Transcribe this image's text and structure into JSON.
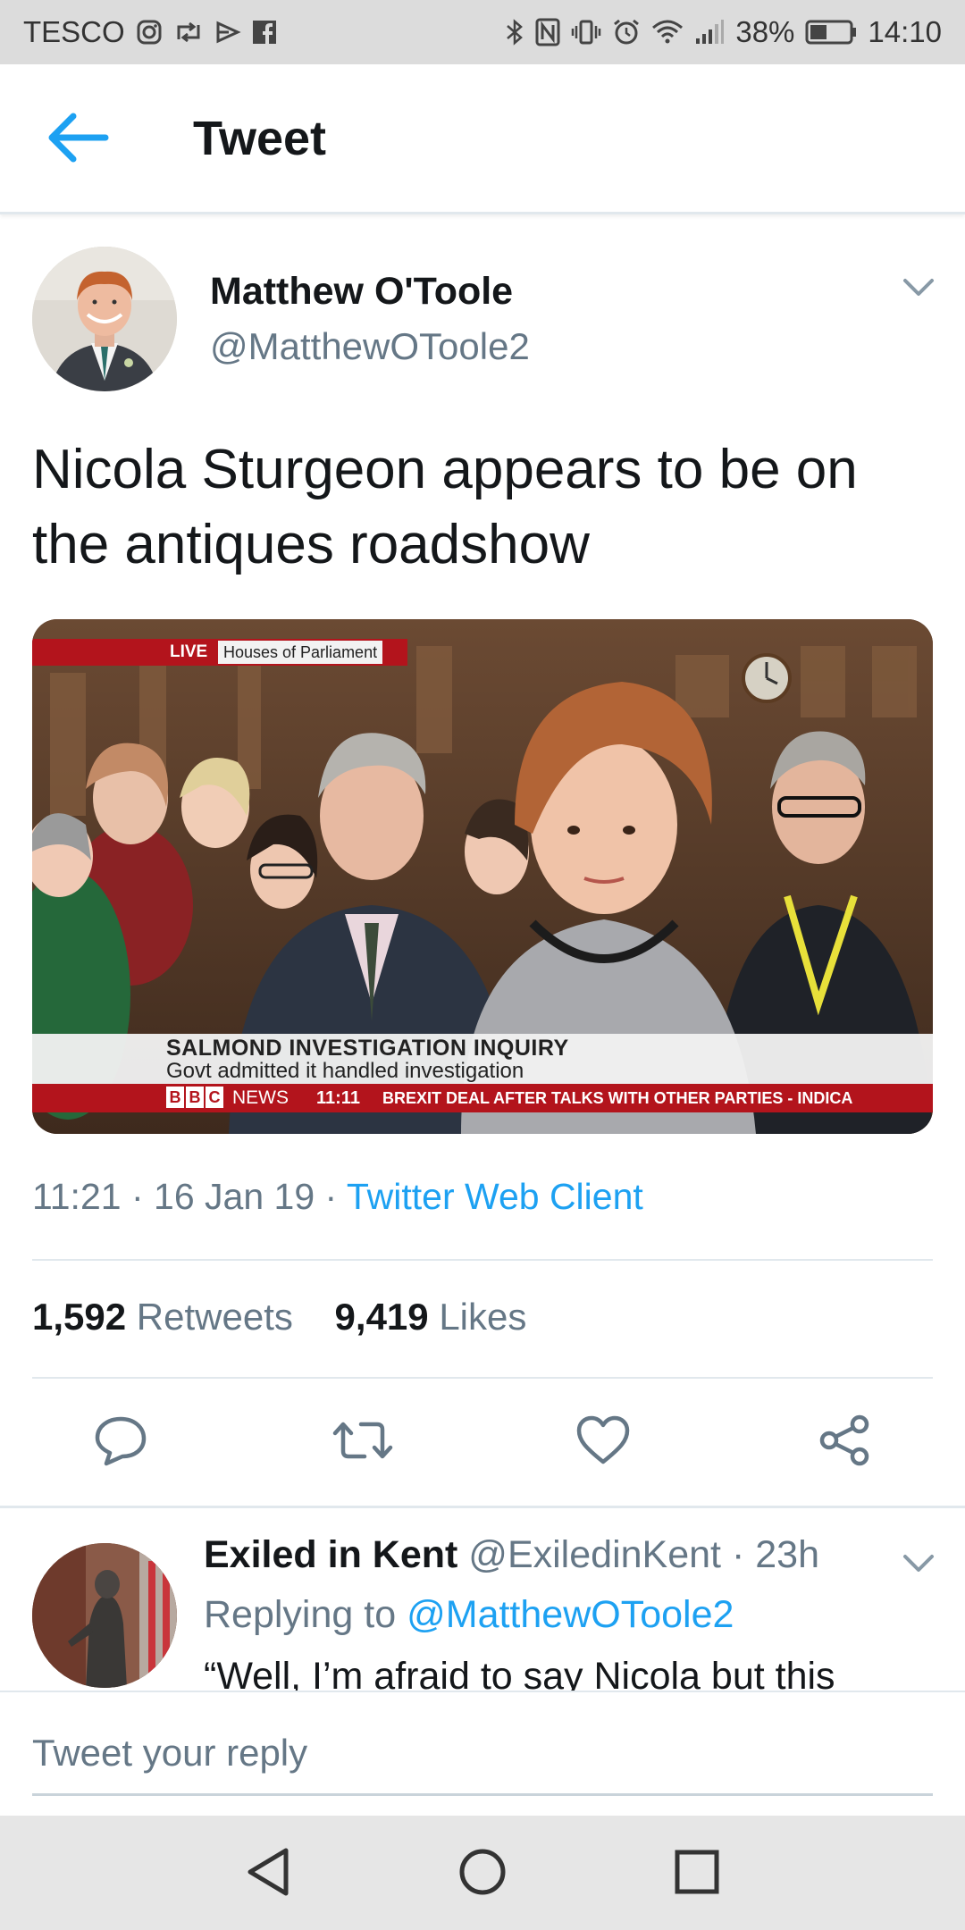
{
  "status_bar": {
    "carrier": "TESCO",
    "battery": "38%",
    "time": "14:10"
  },
  "app_bar": {
    "title": "Tweet"
  },
  "tweet": {
    "author_name": "Matthew O'Toole",
    "author_handle": "@MatthewOToole2",
    "text": "Nicola Sturgeon appears to be on the antiques roadshow",
    "media": {
      "live_label": "LIVE",
      "location_label": "Houses of Parliament",
      "headline": "SALMOND INVESTIGATION INQUIRY",
      "subheadline": "Govt admitted it handled investigation",
      "channel_letters": [
        "B",
        "B",
        "C"
      ],
      "channel_name": "NEWS",
      "ticker_time": "11:11",
      "ticker_text": "BREXIT DEAL AFTER TALKS WITH OTHER PARTIES - INDICA"
    },
    "time": "11:21",
    "date": "16 Jan 19",
    "separator": "·",
    "source": "Twitter Web Client",
    "retweets_count": "1,592",
    "retweets_label": "Retweets",
    "likes_count": "9,419",
    "likes_label": "Likes"
  },
  "reply": {
    "author_name": "Exiled in Kent",
    "author_handle": "@ExiledinKent",
    "age": "23h",
    "replying_label": "Replying to",
    "replying_handle": "@MatthewOToole2",
    "text": "“Well, I’m afraid to say Nicola but this"
  },
  "composer": {
    "placeholder": "Tweet your reply"
  },
  "colors": {
    "accent": "#1da1f2",
    "secondary_text": "#657786",
    "primary_text": "#14171a",
    "bbc_red": "#b3141c"
  }
}
